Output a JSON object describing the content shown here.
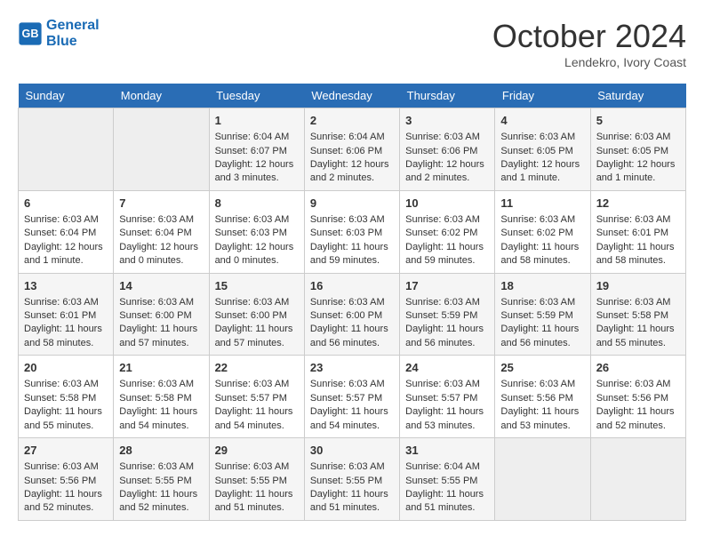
{
  "header": {
    "logo_line1": "General",
    "logo_line2": "Blue",
    "month_title": "October 2024",
    "location": "Lendekro, Ivory Coast"
  },
  "days_of_week": [
    "Sunday",
    "Monday",
    "Tuesday",
    "Wednesday",
    "Thursday",
    "Friday",
    "Saturday"
  ],
  "weeks": [
    [
      {
        "day": "",
        "info": ""
      },
      {
        "day": "",
        "info": ""
      },
      {
        "day": "1",
        "info": "Sunrise: 6:04 AM\nSunset: 6:07 PM\nDaylight: 12 hours and 3 minutes."
      },
      {
        "day": "2",
        "info": "Sunrise: 6:04 AM\nSunset: 6:06 PM\nDaylight: 12 hours and 2 minutes."
      },
      {
        "day": "3",
        "info": "Sunrise: 6:03 AM\nSunset: 6:06 PM\nDaylight: 12 hours and 2 minutes."
      },
      {
        "day": "4",
        "info": "Sunrise: 6:03 AM\nSunset: 6:05 PM\nDaylight: 12 hours and 1 minute."
      },
      {
        "day": "5",
        "info": "Sunrise: 6:03 AM\nSunset: 6:05 PM\nDaylight: 12 hours and 1 minute."
      }
    ],
    [
      {
        "day": "6",
        "info": "Sunrise: 6:03 AM\nSunset: 6:04 PM\nDaylight: 12 hours and 1 minute."
      },
      {
        "day": "7",
        "info": "Sunrise: 6:03 AM\nSunset: 6:04 PM\nDaylight: 12 hours and 0 minutes."
      },
      {
        "day": "8",
        "info": "Sunrise: 6:03 AM\nSunset: 6:03 PM\nDaylight: 12 hours and 0 minutes."
      },
      {
        "day": "9",
        "info": "Sunrise: 6:03 AM\nSunset: 6:03 PM\nDaylight: 11 hours and 59 minutes."
      },
      {
        "day": "10",
        "info": "Sunrise: 6:03 AM\nSunset: 6:02 PM\nDaylight: 11 hours and 59 minutes."
      },
      {
        "day": "11",
        "info": "Sunrise: 6:03 AM\nSunset: 6:02 PM\nDaylight: 11 hours and 58 minutes."
      },
      {
        "day": "12",
        "info": "Sunrise: 6:03 AM\nSunset: 6:01 PM\nDaylight: 11 hours and 58 minutes."
      }
    ],
    [
      {
        "day": "13",
        "info": "Sunrise: 6:03 AM\nSunset: 6:01 PM\nDaylight: 11 hours and 58 minutes."
      },
      {
        "day": "14",
        "info": "Sunrise: 6:03 AM\nSunset: 6:00 PM\nDaylight: 11 hours and 57 minutes."
      },
      {
        "day": "15",
        "info": "Sunrise: 6:03 AM\nSunset: 6:00 PM\nDaylight: 11 hours and 57 minutes."
      },
      {
        "day": "16",
        "info": "Sunrise: 6:03 AM\nSunset: 6:00 PM\nDaylight: 11 hours and 56 minutes."
      },
      {
        "day": "17",
        "info": "Sunrise: 6:03 AM\nSunset: 5:59 PM\nDaylight: 11 hours and 56 minutes."
      },
      {
        "day": "18",
        "info": "Sunrise: 6:03 AM\nSunset: 5:59 PM\nDaylight: 11 hours and 56 minutes."
      },
      {
        "day": "19",
        "info": "Sunrise: 6:03 AM\nSunset: 5:58 PM\nDaylight: 11 hours and 55 minutes."
      }
    ],
    [
      {
        "day": "20",
        "info": "Sunrise: 6:03 AM\nSunset: 5:58 PM\nDaylight: 11 hours and 55 minutes."
      },
      {
        "day": "21",
        "info": "Sunrise: 6:03 AM\nSunset: 5:58 PM\nDaylight: 11 hours and 54 minutes."
      },
      {
        "day": "22",
        "info": "Sunrise: 6:03 AM\nSunset: 5:57 PM\nDaylight: 11 hours and 54 minutes."
      },
      {
        "day": "23",
        "info": "Sunrise: 6:03 AM\nSunset: 5:57 PM\nDaylight: 11 hours and 54 minutes."
      },
      {
        "day": "24",
        "info": "Sunrise: 6:03 AM\nSunset: 5:57 PM\nDaylight: 11 hours and 53 minutes."
      },
      {
        "day": "25",
        "info": "Sunrise: 6:03 AM\nSunset: 5:56 PM\nDaylight: 11 hours and 53 minutes."
      },
      {
        "day": "26",
        "info": "Sunrise: 6:03 AM\nSunset: 5:56 PM\nDaylight: 11 hours and 52 minutes."
      }
    ],
    [
      {
        "day": "27",
        "info": "Sunrise: 6:03 AM\nSunset: 5:56 PM\nDaylight: 11 hours and 52 minutes."
      },
      {
        "day": "28",
        "info": "Sunrise: 6:03 AM\nSunset: 5:55 PM\nDaylight: 11 hours and 52 minutes."
      },
      {
        "day": "29",
        "info": "Sunrise: 6:03 AM\nSunset: 5:55 PM\nDaylight: 11 hours and 51 minutes."
      },
      {
        "day": "30",
        "info": "Sunrise: 6:03 AM\nSunset: 5:55 PM\nDaylight: 11 hours and 51 minutes."
      },
      {
        "day": "31",
        "info": "Sunrise: 6:04 AM\nSunset: 5:55 PM\nDaylight: 11 hours and 51 minutes."
      },
      {
        "day": "",
        "info": ""
      },
      {
        "day": "",
        "info": ""
      }
    ]
  ]
}
